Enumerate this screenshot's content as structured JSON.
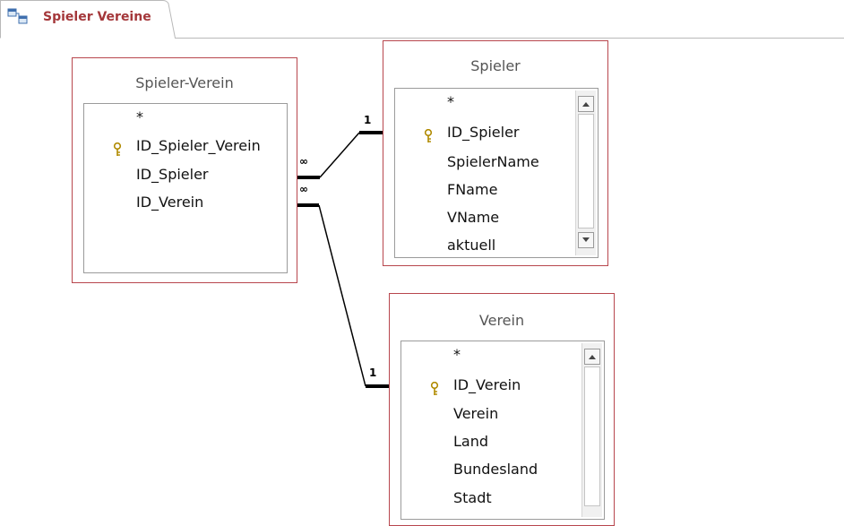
{
  "tab": {
    "title": "Spieler Vereine",
    "icon": "relationships-icon"
  },
  "tables": {
    "spieler_verein": {
      "title": "Spieler-Verein",
      "fields": [
        {
          "name": "*",
          "key": false
        },
        {
          "name": "ID_Spieler_Verein",
          "key": true
        },
        {
          "name": "ID_Spieler",
          "key": false
        },
        {
          "name": "ID_Verein",
          "key": false
        }
      ]
    },
    "spieler": {
      "title": "Spieler",
      "fields": [
        {
          "name": "*",
          "key": false
        },
        {
          "name": "ID_Spieler",
          "key": true
        },
        {
          "name": "SpielerName",
          "key": false
        },
        {
          "name": "FName",
          "key": false
        },
        {
          "name": "VName",
          "key": false
        },
        {
          "name": "aktuell",
          "key": false
        }
      ]
    },
    "verein": {
      "title": "Verein",
      "fields": [
        {
          "name": "*",
          "key": false
        },
        {
          "name": "ID_Verein",
          "key": true
        },
        {
          "name": "Verein",
          "key": false
        },
        {
          "name": "Land",
          "key": false
        },
        {
          "name": "Bundesland",
          "key": false
        },
        {
          "name": "Stadt",
          "key": false
        }
      ]
    }
  },
  "relationships": [
    {
      "from": "Spieler-Verein.ID_Spieler",
      "to": "Spieler.ID_Spieler",
      "many_label": "∞",
      "one_label": "1"
    },
    {
      "from": "Spieler-Verein.ID_Verein",
      "to": "Verein.ID_Verein",
      "many_label": "∞",
      "one_label": "1"
    }
  ],
  "colors": {
    "tab_title": "#a4373a",
    "table_border": "#b8464d",
    "key_icon": "#d4a017"
  }
}
